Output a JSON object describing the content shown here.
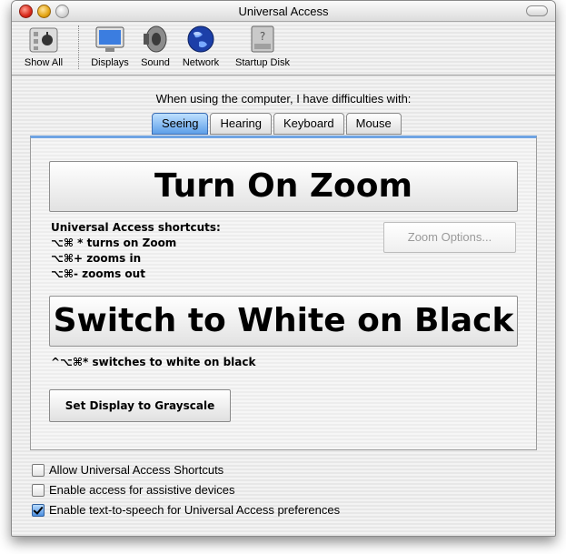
{
  "window": {
    "title": "Universal Access"
  },
  "toolbar": {
    "items": [
      {
        "label": "Show All",
        "icon": "apple-icon"
      },
      {
        "label": "Displays",
        "icon": "display-icon"
      },
      {
        "label": "Sound",
        "icon": "speaker-icon"
      },
      {
        "label": "Network",
        "icon": "globe-icon"
      },
      {
        "label": "Startup Disk",
        "icon": "disk-icon"
      }
    ]
  },
  "prompt": "When using the computer, I have difficulties with:",
  "tabs": [
    {
      "label": "Seeing",
      "selected": true
    },
    {
      "label": "Hearing",
      "selected": false
    },
    {
      "label": "Keyboard",
      "selected": false
    },
    {
      "label": "Mouse",
      "selected": false
    }
  ],
  "seeing": {
    "zoom_button": "Turn On Zoom",
    "shortcuts_title": "Universal Access shortcuts:",
    "shortcut_lines": [
      "⌥⌘ * turns on Zoom",
      "⌥⌘+ zooms in",
      "⌥⌘- zooms out"
    ],
    "zoom_options_button": "Zoom Options...",
    "white_on_black_button": "Switch to White on Black",
    "white_on_black_shortcut": "^⌥⌘* switches to white on black",
    "grayscale_button": "Set Display to Grayscale"
  },
  "options": [
    {
      "label": "Allow Universal Access Shortcuts",
      "checked": false
    },
    {
      "label": "Enable access for assistive devices",
      "checked": false
    },
    {
      "label": "Enable text-to-speech for Universal Access preferences",
      "checked": true
    }
  ],
  "colors": {
    "tab_selected": "#5d9ee8",
    "panel_accent": "#6fa4e3"
  }
}
